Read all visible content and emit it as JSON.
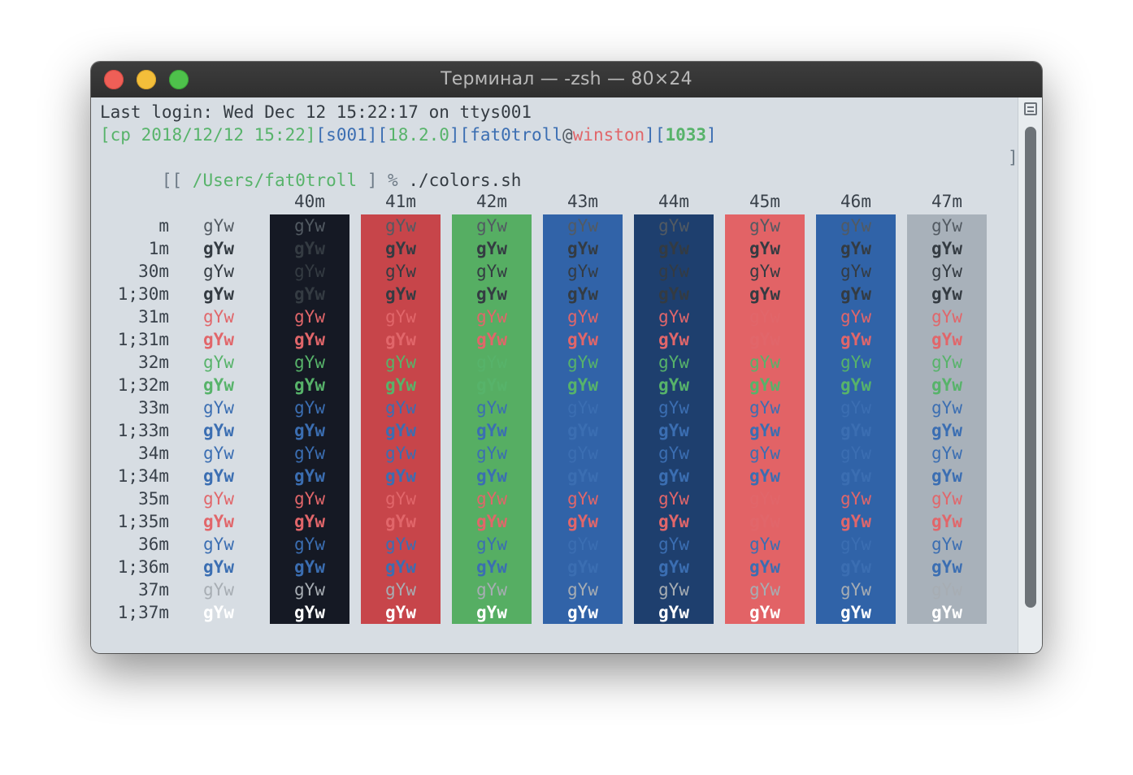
{
  "window": {
    "title": "Терминал — -zsh — 80×24"
  },
  "terminal": {
    "last_login": "Last login: Wed Dec 12 15:22:17 on ttys001",
    "prompt_parts": [
      {
        "text": "[cp 2018/12/12 15:22]",
        "color": "#57b36a"
      },
      {
        "text": "[",
        "color": "#3b6eb2"
      },
      {
        "text": "s001",
        "color": "#3b6eb2"
      },
      {
        "text": "][",
        "color": "#3b6eb2"
      },
      {
        "text": "18.2.0",
        "color": "#57b36a"
      },
      {
        "text": "][",
        "color": "#3b6eb2"
      },
      {
        "text": "fat0troll",
        "color": "#3b6eb2"
      },
      {
        "text": "@",
        "color": "#525a62"
      },
      {
        "text": "winston",
        "color": "#e1666a"
      },
      {
        "text": "][",
        "color": "#3b6eb2"
      },
      {
        "text": "1033",
        "color": "#57b36a",
        "bold": true
      },
      {
        "text": "]",
        "color": "#3b6eb2"
      }
    ],
    "command_line": {
      "open": "[[ ",
      "path": "/Users/fat0troll",
      "close": " ] %",
      "command": " ./colors.sh",
      "right_bracket": "]"
    },
    "headers": [
      "40m",
      "41m",
      "42m",
      "43m",
      "44m",
      "45m",
      "46m",
      "47m"
    ],
    "sample_text": "gYw",
    "rows": [
      "m",
      "1m",
      "30m",
      "1;30m",
      "31m",
      "1;31m",
      "32m",
      "1;32m",
      "33m",
      "1;33m",
      "34m",
      "1;34m",
      "35m",
      "1;35m",
      "36m",
      "1;36m",
      "37m",
      "1;37m"
    ]
  },
  "colors": {
    "fg": [
      "#525a62",
      "#343b42",
      "#e1666a",
      "#57b36a",
      "#3b6eb2",
      "#3b6eb2",
      "#e1666a",
      "#3b6eb2",
      "#ffffff"
    ],
    "bg_columns": [
      "#151924",
      "#c7454a",
      "#56ae63",
      "#3163a8",
      "#1e3f6e",
      "#e26366",
      "#3063a8",
      "#a8b1ba"
    ]
  }
}
